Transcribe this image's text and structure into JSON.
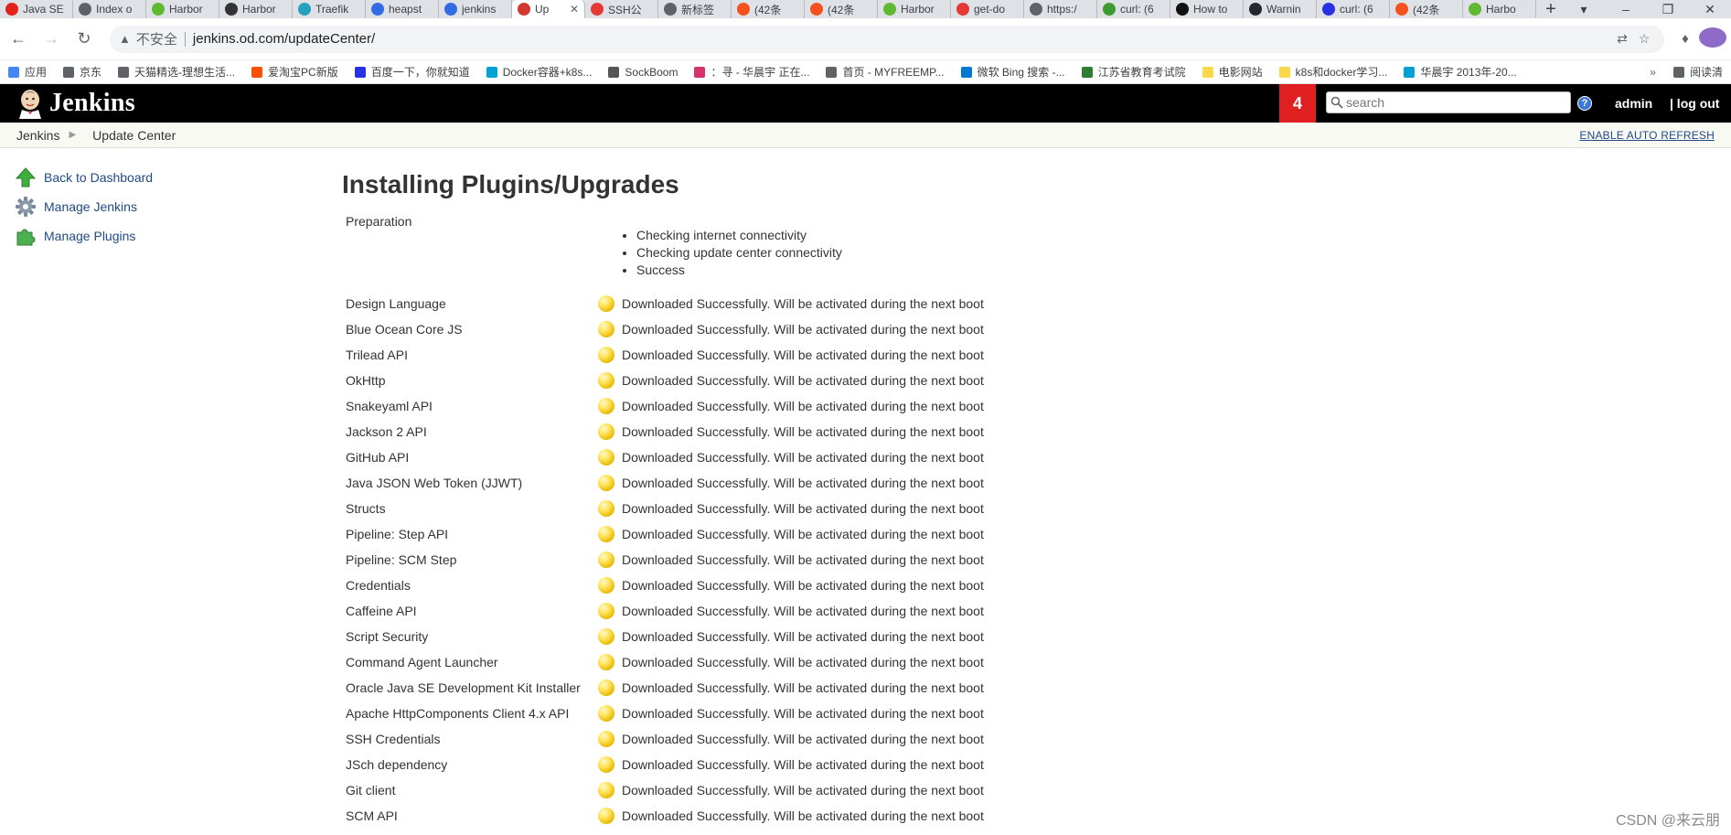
{
  "browser": {
    "tabs": [
      {
        "title": "Java SE",
        "color": "#e2231a",
        "icon": "oracle-icon"
      },
      {
        "title": "Index o",
        "color": "#5f6368",
        "icon": "globe-icon"
      },
      {
        "title": "Harbor",
        "color": "#60b932",
        "icon": "harbor-icon"
      },
      {
        "title": "Harbor",
        "color": "#333333",
        "icon": "harbor-icon"
      },
      {
        "title": "Traefik",
        "color": "#24a1c1",
        "icon": "traefik-icon"
      },
      {
        "title": "heapst",
        "color": "#326ce5",
        "icon": "kubernetes-icon"
      },
      {
        "title": "jenkins",
        "color": "#326ce5",
        "icon": "kubernetes-icon"
      },
      {
        "title": "Up",
        "color": "#d33833",
        "icon": "jenkins-icon",
        "active": true
      },
      {
        "title": "SSH公",
        "color": "#e53935",
        "icon": "csdn-icon"
      },
      {
        "title": "新标签",
        "color": "#5f6368",
        "icon": "newtab-icon"
      },
      {
        "title": "(42条",
        "color": "#f4511e",
        "icon": "csdn-icon"
      },
      {
        "title": "(42条",
        "color": "#f4511e",
        "icon": "csdn-icon"
      },
      {
        "title": "Harbor",
        "color": "#60b932",
        "icon": "harbor-icon"
      },
      {
        "title": "get-do",
        "color": "#e53935",
        "icon": "csdn-icon"
      },
      {
        "title": "https:/",
        "color": "#5f6368",
        "icon": "globe-icon"
      },
      {
        "title": "curl: (6",
        "color": "#3e9b2f",
        "icon": "site-icon"
      },
      {
        "title": "How to",
        "color": "#111111",
        "icon": "site-icon"
      },
      {
        "title": "Warnin",
        "color": "#24292e",
        "icon": "github-icon"
      },
      {
        "title": "curl: (6",
        "color": "#2932e1",
        "icon": "baidu-icon"
      },
      {
        "title": "(42条",
        "color": "#f4511e",
        "icon": "csdn-icon"
      },
      {
        "title": "Harbo",
        "color": "#60b932",
        "icon": "harbor-icon"
      }
    ],
    "insecure_label": "不安全",
    "url": "jenkins.od.com/updateCenter/",
    "bookmarks": [
      {
        "label": "应用",
        "color": "#4285f4"
      },
      {
        "label": "京东",
        "color": "#5f6368"
      },
      {
        "label": "天猫精选-理想生活...",
        "color": "#5f6368"
      },
      {
        "label": "爱淘宝PC新版",
        "color": "#ff5000"
      },
      {
        "label": "百度一下，你就知道",
        "color": "#2932e1"
      },
      {
        "label": "Docker容器+k8s...",
        "color": "#00a1d6"
      },
      {
        "label": "SockBoom",
        "color": "#555555"
      },
      {
        "label": "：寻 - 华晨宇 正在...",
        "color": "#d6336c"
      },
      {
        "label": "首页 - MYFREEMP...",
        "color": "#5f6368"
      },
      {
        "label": "微软 Bing 搜索 -...",
        "color": "#0078d4"
      },
      {
        "label": "江苏省教育考试院",
        "color": "#2e7d32"
      },
      {
        "label": "电影网站",
        "color": "#f9d849"
      },
      {
        "label": "k8s和docker学习...",
        "color": "#f9d849"
      },
      {
        "label": "华晨宇 2013年-20...",
        "color": "#00a1d6"
      }
    ],
    "reading_list": "阅读清"
  },
  "jenkins": {
    "logo_text": "Jenkins",
    "notification_count": "4",
    "search_placeholder": "search",
    "user": "admin",
    "logout": "| log out",
    "breadcrumbs": [
      "Jenkins",
      "Update Center"
    ],
    "auto_refresh": "ENABLE AUTO REFRESH",
    "side_tasks": [
      {
        "label": "Back to Dashboard",
        "icon": "up-arrow-icon"
      },
      {
        "label": "Manage Jenkins",
        "icon": "gear-icon"
      },
      {
        "label": "Manage Plugins",
        "icon": "puzzle-icon"
      }
    ],
    "title": "Installing Plugins/Upgrades",
    "preparation": {
      "label": "Preparation",
      "steps": [
        "Checking internet connectivity",
        "Checking update center connectivity",
        "Success"
      ]
    },
    "status_text": "Downloaded Successfully. Will be activated during the next boot",
    "status_color": "#f2c200",
    "plugins": [
      "Design Language",
      "Blue Ocean Core JS",
      "Trilead API",
      "OkHttp",
      "Snakeyaml API",
      "Jackson 2 API",
      "GitHub API",
      "Java JSON Web Token (JJWT)",
      "Structs",
      "Pipeline: Step API",
      "Pipeline: SCM Step",
      "Credentials",
      "Caffeine API",
      "Script Security",
      "Command Agent Launcher",
      "Oracle Java SE Development Kit Installer",
      "Apache HttpComponents Client 4.x API",
      "SSH Credentials",
      "JSch dependency",
      "Git client",
      "SCM API"
    ]
  },
  "watermark": "CSDN @来云朋"
}
